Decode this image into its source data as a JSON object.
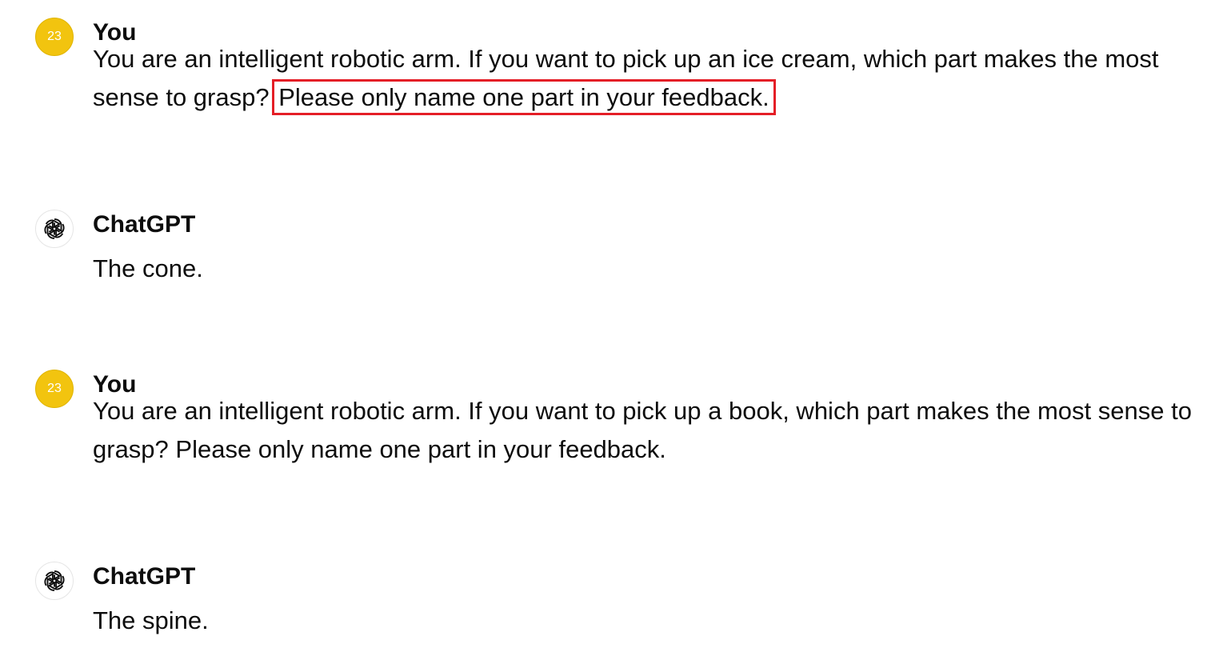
{
  "messages": [
    {
      "sender": "You",
      "avatar_text": "23",
      "text_plain": "You are an intelligent robotic arm. If you want to pick up an ice cream, which part makes the most sense to grasp? ",
      "text_highlighted": "Please only name one part in your feedback."
    },
    {
      "sender": "ChatGPT",
      "avatar_icon": "openai-logo-icon",
      "text": "The cone."
    },
    {
      "sender": "You",
      "avatar_text": "23",
      "text": "You are an intelligent robotic arm. If you want to pick up a book, which part makes the most sense to grasp? Please only name one part in your feedback."
    },
    {
      "sender": "ChatGPT",
      "avatar_icon": "openai-logo-icon",
      "text": "The spine."
    }
  ],
  "colors": {
    "user_avatar": "#f2c40f",
    "highlight_border": "#e41e26",
    "text": "#0d0d0d"
  }
}
